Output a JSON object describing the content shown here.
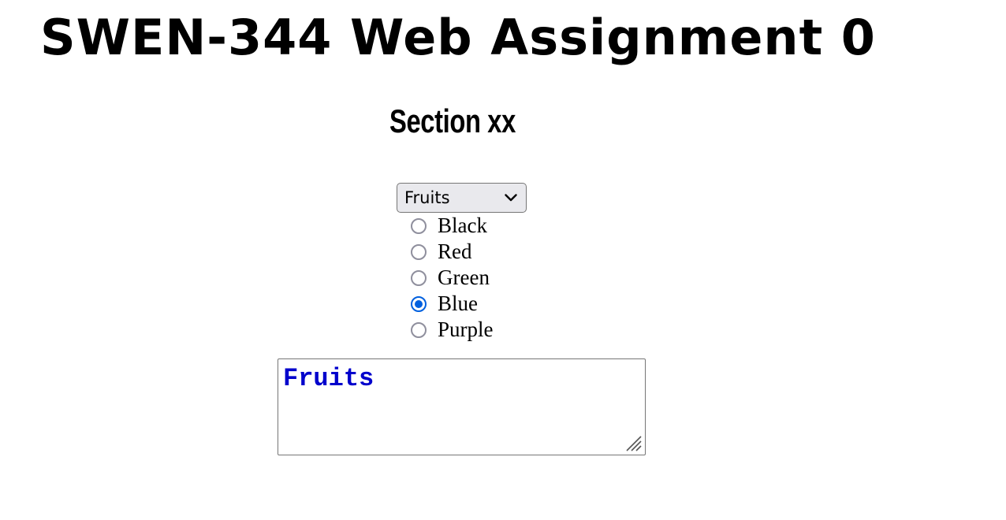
{
  "header": {
    "title": "SWEN-344 Web Assignment 0",
    "section": "Section xx"
  },
  "category_select": {
    "selected": "Fruits",
    "icon": "chevron-down-icon"
  },
  "colors": {
    "options": [
      {
        "label": "Black",
        "checked": false
      },
      {
        "label": "Red",
        "checked": false
      },
      {
        "label": "Green",
        "checked": false
      },
      {
        "label": "Blue",
        "checked": true
      },
      {
        "label": "Purple",
        "checked": false
      }
    ],
    "radio_accent": "#0060df",
    "radio_border": "#8f8f9d"
  },
  "output": {
    "value": "Fruits",
    "text_color": "#0000cc"
  }
}
